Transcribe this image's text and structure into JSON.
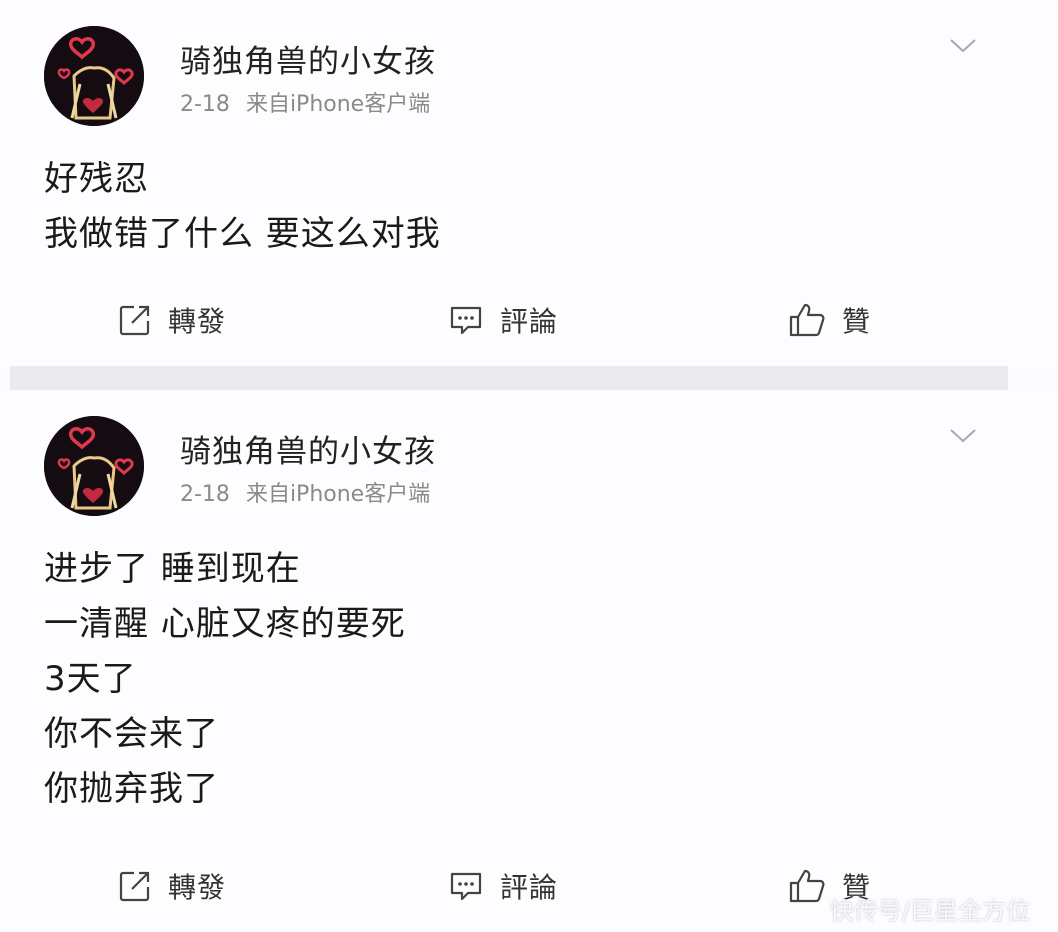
{
  "posts": [
    {
      "username": "骑独角兽的小女孩",
      "date": "2-18",
      "source": "来自iPhone客户端",
      "content": [
        "好残忍",
        "我做错了什么 要这么对我"
      ],
      "actions": {
        "repost_label": "轉發",
        "comment_label": "評論",
        "like_label": "贊"
      }
    },
    {
      "username": "骑独角兽的小女孩",
      "date": "2-18",
      "source": "来自iPhone客户端",
      "content": [
        "进步了 睡到现在",
        "一清醒 心脏又疼的要死",
        "3天了",
        "你不会来了",
        "你抛弃我了"
      ],
      "actions": {
        "repost_label": "轉發",
        "comment_label": "評論",
        "like_label": "贊"
      }
    }
  ],
  "watermark": "快传号/巨星全方位",
  "icons": {
    "avatar": "avatar-heart-icon",
    "chevron": "chevron-down-icon",
    "repost": "repost-icon",
    "comment": "comment-icon",
    "like": "thumbs-up-icon"
  },
  "colors": {
    "username": "#222222",
    "meta": "#8a8a8a",
    "separator": "#ebebef",
    "avatar_background": "#140c10",
    "avatar_hearts": "#e0384f"
  }
}
